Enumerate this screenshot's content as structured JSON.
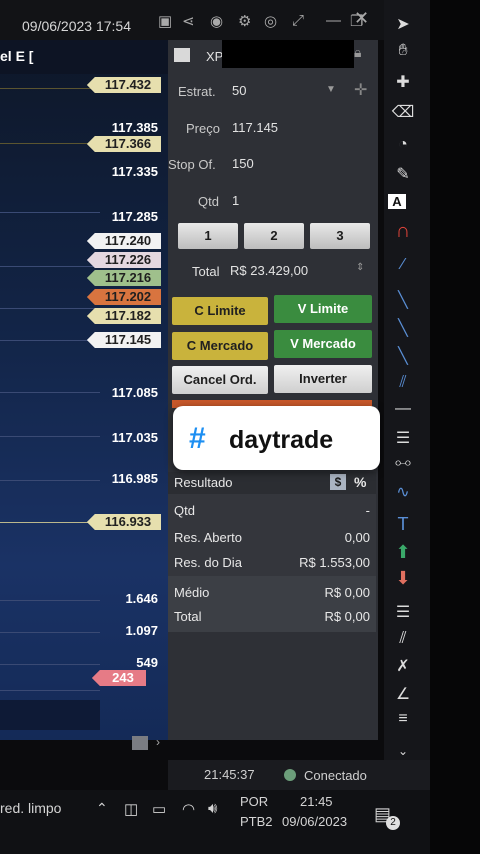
{
  "titlebar": {
    "datetime": "09/06/2023 17:54"
  },
  "chart": {
    "header": "el E [",
    "price_labels": [
      "117.385",
      "117.335",
      "117.285",
      "117.085",
      "117.035",
      "116.985"
    ],
    "volume_labels": [
      "1.646",
      "1.097",
      "549"
    ],
    "tags": [
      {
        "text": "117.432",
        "color": "#e6dfae"
      },
      {
        "text": "117.366",
        "color": "#e6dfae"
      },
      {
        "text": "117.240",
        "color": "#f2f2f2"
      },
      {
        "text": "117.226",
        "color": "#e4d7df"
      },
      {
        "text": "117.216",
        "color": "#9fc08c"
      },
      {
        "text": "117.202",
        "color": "#d8743f"
      },
      {
        "text": "117.182",
        "color": "#e6dfae"
      },
      {
        "text": "117.145",
        "color": "#f2f2f2"
      },
      {
        "text": "116.933",
        "color": "#e6dfae"
      },
      {
        "text": "243",
        "color": "#e67b86"
      }
    ]
  },
  "order_panel": {
    "account": "XP",
    "strat_label": "Estrat.",
    "strat_value": "50",
    "price_label": "Preço",
    "price_value": "117.145",
    "stop_label": "Stop Of.",
    "stop_value": "150",
    "qty_label": "Qtd",
    "qty_value": "1",
    "qty_buttons": [
      "1",
      "2",
      "3"
    ],
    "total_label": "Total",
    "total_value": "R$ 23.429,00",
    "buttons": {
      "c_limite": "C Limite",
      "v_limite": "V Limite",
      "c_mercado": "C Mercado",
      "v_mercado": "V Mercado",
      "cancel": "Cancel Ord.",
      "inverter": "Inverter"
    }
  },
  "overlay": {
    "hash": "#",
    "text": "daytrade"
  },
  "results": {
    "title": "Resultado",
    "currency_btn": "$",
    "percent_btn": "%",
    "rows": [
      {
        "label": "Qtd",
        "value": "-"
      },
      {
        "label": "Res. Aberto",
        "value": "0,00"
      },
      {
        "label": "Res. do Dia",
        "value": "R$ 1.553,00"
      },
      {
        "label": "Médio",
        "value": "R$ 0,00"
      },
      {
        "label": "Total",
        "value": "R$ 0,00"
      }
    ]
  },
  "status": {
    "time": "21:45:37",
    "connection": "Conectado"
  },
  "taskbar": {
    "left_text": "red. limpo",
    "lang": "POR",
    "layout": "PTB2",
    "time": "21:45",
    "date": "09/06/2023",
    "notif_count": "2"
  },
  "colors": {
    "buy": "#c9b33c",
    "sell": "#3a8c3f",
    "accent": "#1d8ff2"
  }
}
